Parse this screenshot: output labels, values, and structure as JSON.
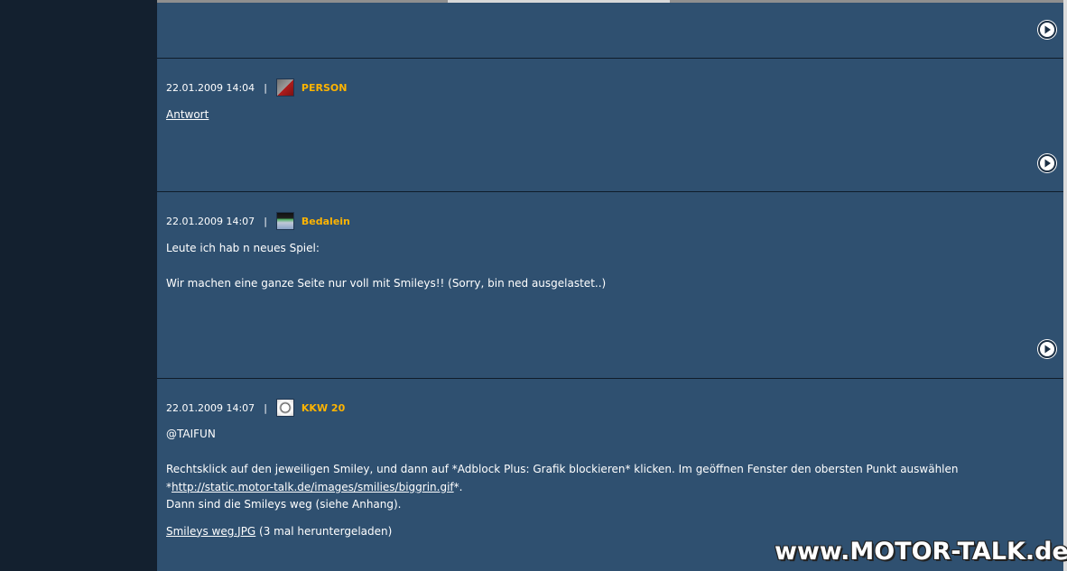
{
  "posts": [
    {
      "id": "p0",
      "next_icon": "arrow-right-icon"
    },
    {
      "id": "p1",
      "date": "22.01.2009 14:04",
      "separator": "|",
      "username": "PERSON",
      "body_link": "Antwort",
      "next_icon": "arrow-right-icon"
    },
    {
      "id": "p2",
      "date": "22.01.2009 14:07",
      "separator": "|",
      "username": "Bedalein",
      "line1": "Leute ich hab n neues Spiel:",
      "line2": "Wir machen eine ganze Seite nur voll mit Smileys!! (Sorry, bin ned ausgelastet..)",
      "next_icon": "arrow-right-icon"
    },
    {
      "id": "p3",
      "date": "22.01.2009 14:07",
      "separator": "|",
      "username": "KKW 20",
      "line1": "@TAIFUN",
      "line2_text": "Rechtsklick auf den jeweiligen Smiley, und dann auf *Adblock Plus: Grafik blockieren* klicken. Im geöffnen Fenster den obersten Punkt auswählen *",
      "line2_link": "http://static.motor-talk.de/images/smilies/biggrin.gif",
      "line2_tail": "*.",
      "line3": "Dann sind die Smileys weg (siehe Anhang).",
      "attachment_link": "Smileys weg.JPG",
      "attachment_info": " (3 mal heruntergeladen)"
    }
  ],
  "watermark": "www.MOTOR-TALK.de",
  "colors": {
    "background": "#2f5070",
    "sidebar": "#13202f",
    "username": "#ffb400"
  }
}
